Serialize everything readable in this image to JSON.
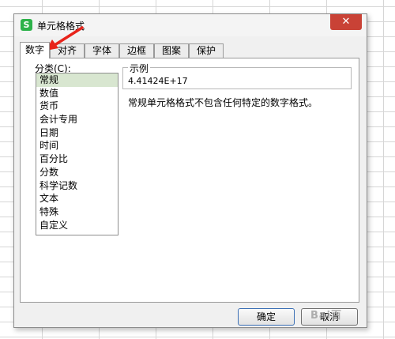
{
  "window": {
    "title": "单元格格式",
    "logo_glyph": "S",
    "close_glyph": "✕"
  },
  "tabs": [
    {
      "label": "数字",
      "active": true
    },
    {
      "label": "对齐"
    },
    {
      "label": "字体"
    },
    {
      "label": "边框"
    },
    {
      "label": "图案"
    },
    {
      "label": "保护"
    }
  ],
  "category": {
    "label": "分类(C):",
    "items": [
      "常规",
      "数值",
      "货币",
      "会计专用",
      "日期",
      "时间",
      "百分比",
      "分数",
      "科学记数",
      "文本",
      "特殊",
      "自定义"
    ],
    "selected": "常规"
  },
  "sample": {
    "label": "示例",
    "value": "4.41424E+17"
  },
  "description": "常规单元格格式不包含任何特定的数字格式。",
  "buttons": {
    "ok": "确定",
    "cancel": "取消"
  },
  "watermark": "Bai百",
  "colors": {
    "close": "#c94236",
    "logo": "#2db24a",
    "selection": "#d8e6d0",
    "arrow": "#e8231a"
  }
}
